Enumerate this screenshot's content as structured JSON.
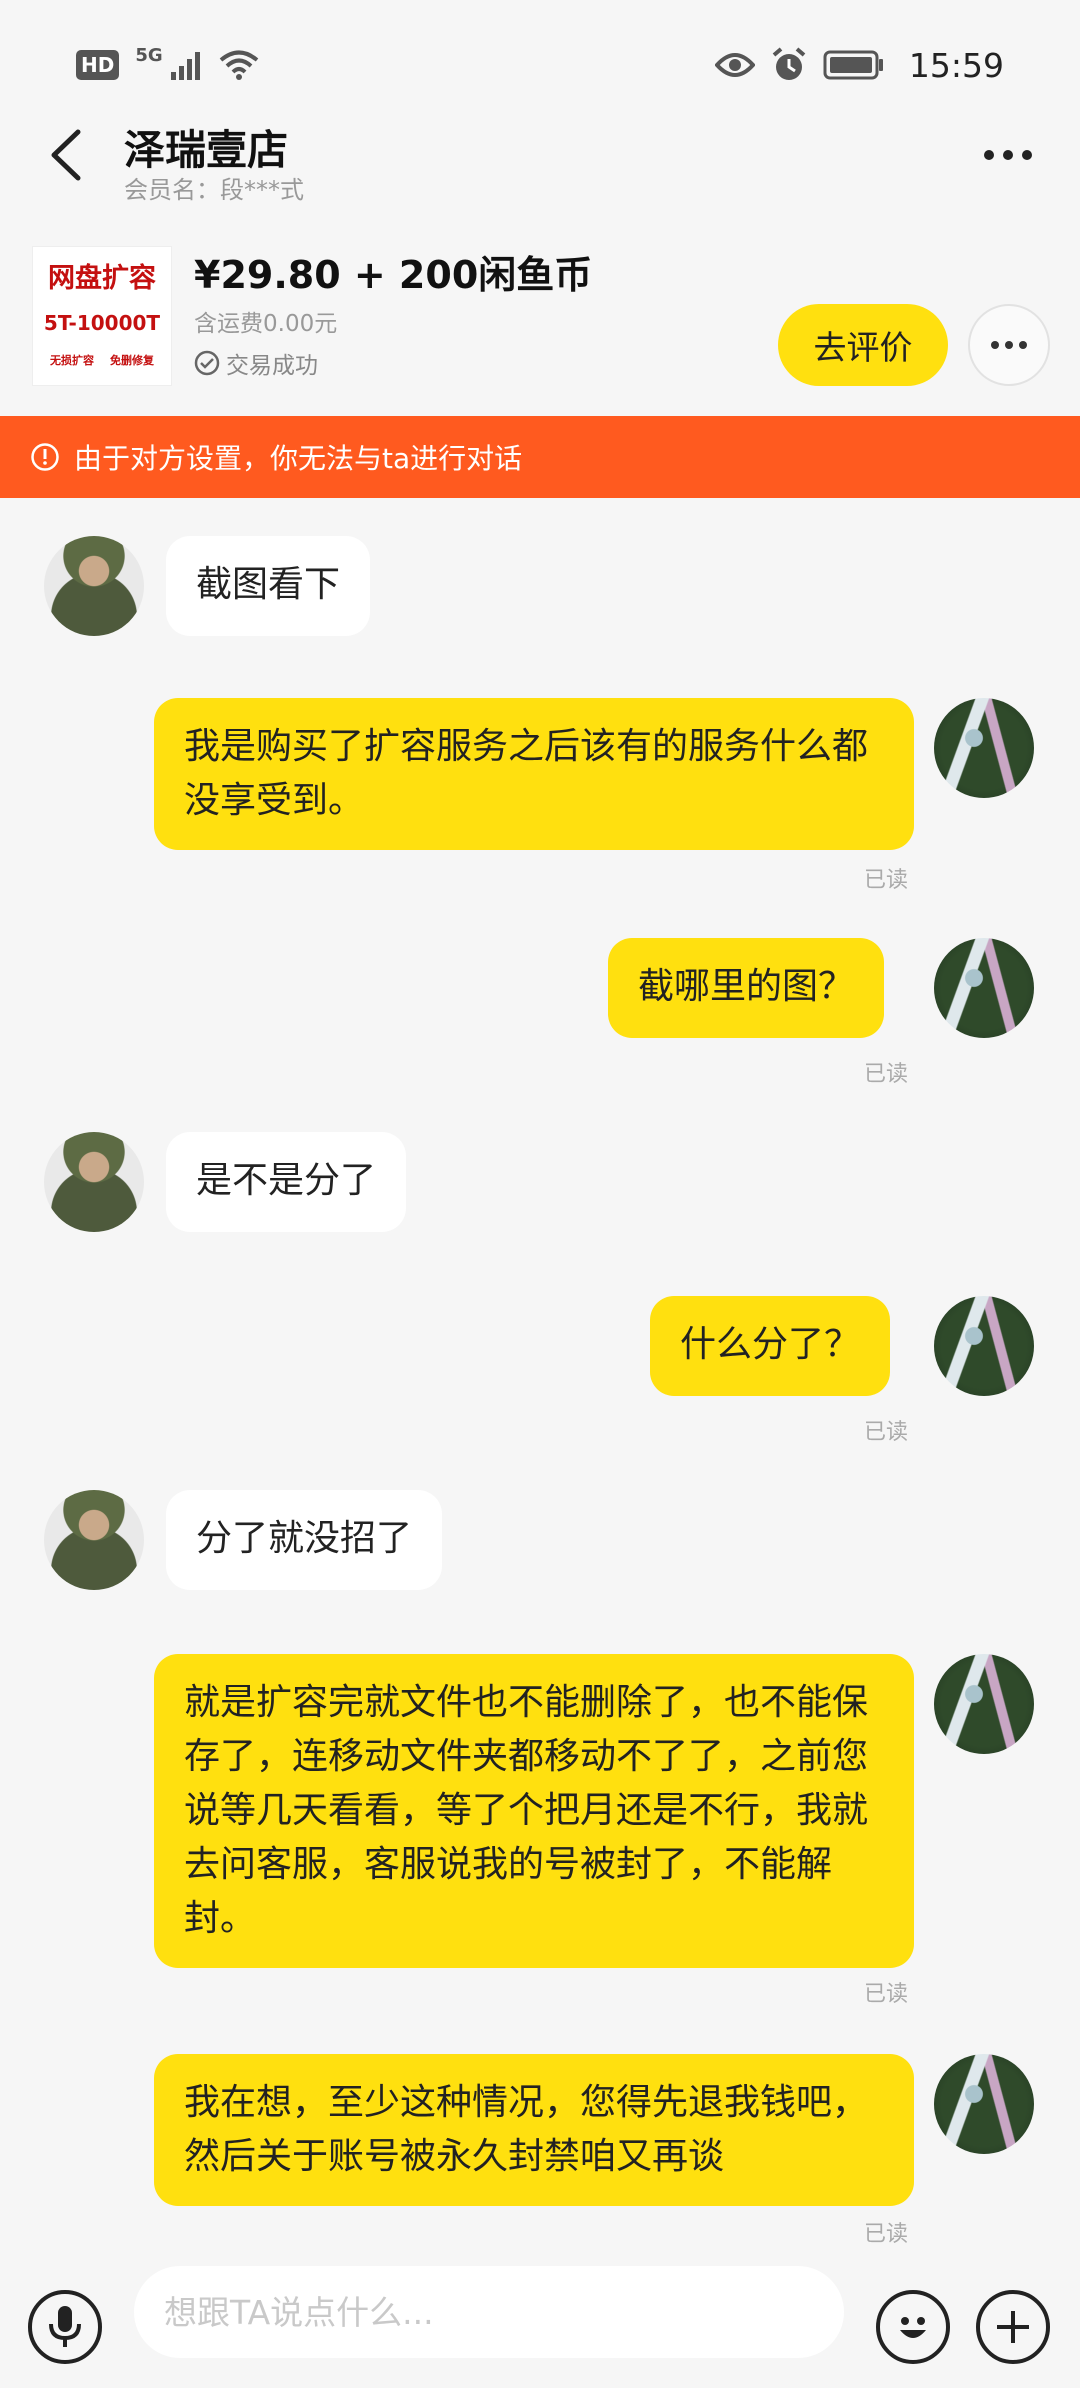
{
  "status_bar": {
    "hd": "HD",
    "network": "5G",
    "time": "15:59",
    "icons": [
      "signal-icon",
      "wifi-icon",
      "eye-icon",
      "alarm-icon",
      "battery-icon"
    ]
  },
  "header": {
    "shop_name": "泽瑞壹店",
    "member_name": "会员名：段***式"
  },
  "product": {
    "thumb_title": "网盘扩容",
    "thumb_spec": "5T-10000T",
    "thumb_tag_left": "无损扩容",
    "thumb_tag_right": "免删修复",
    "price": "¥29.80 + 200闲鱼币",
    "shipping": "含运费0.00元",
    "status": "交易成功",
    "review_button": "去评价"
  },
  "warning": {
    "text": "由于对方设置，你无法与ta进行对话",
    "color": "#ff5a1f"
  },
  "messages": [
    {
      "side": "in",
      "text": "截图看下"
    },
    {
      "side": "out",
      "text": "我是购买了扩容服务之后该有的服务什么都没享受到。",
      "status": "已读"
    },
    {
      "side": "out",
      "text": "截哪里的图？",
      "status": "已读"
    },
    {
      "side": "in",
      "text": "是不是分了"
    },
    {
      "side": "out",
      "text": "什么分了？",
      "status": "已读"
    },
    {
      "side": "in",
      "text": "分了就没招了"
    },
    {
      "side": "out",
      "text": "就是扩容完就文件也不能删除了，也不能保存了，连移动文件夹都移动不了了，之前您说等几天看看，等了个把月还是不行，我就去问客服，客服说我的号被封了，不能解封。",
      "status": "已读"
    },
    {
      "side": "out",
      "text": "我在想，至少这种情况，您得先退我钱吧，然后关于账号被永久封禁咱又再谈",
      "status": "已读"
    }
  ],
  "input": {
    "placeholder": "想跟TA说点什么..."
  },
  "colors": {
    "accent": "#ffe00f",
    "background": "#f6f6f6"
  }
}
